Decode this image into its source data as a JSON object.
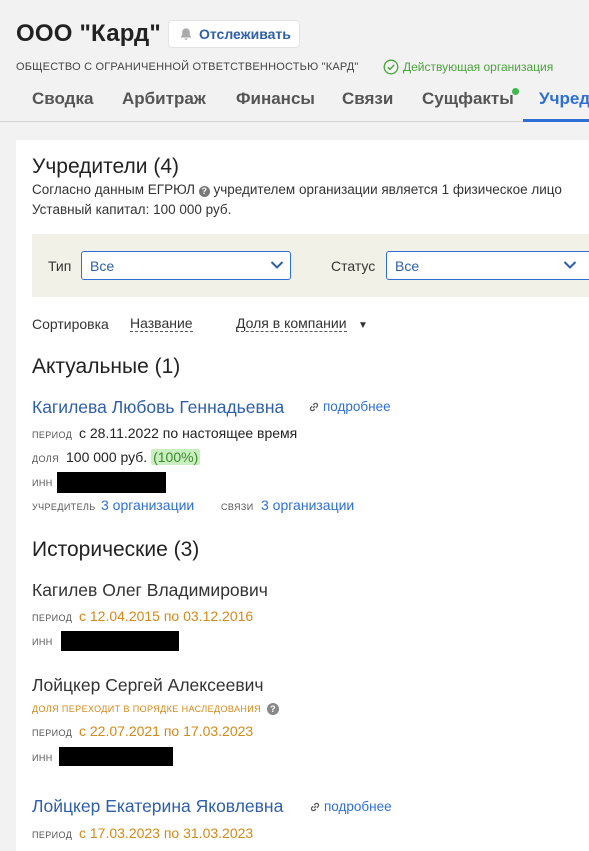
{
  "header": {
    "company_name": "ООО \"Кард\"",
    "follow_label": "Отслеживать",
    "full_name": "ОБЩЕСТВО С ОГРАНИЧЕННОЙ ОТВЕТСТВЕННОСТЬЮ \"КАРД\"",
    "status": "Действующая организация"
  },
  "tabs": [
    {
      "label": "Сводка"
    },
    {
      "label": "Арбитраж"
    },
    {
      "label": "Финансы"
    },
    {
      "label": "Связи"
    },
    {
      "label": "Сущфакты"
    },
    {
      "label": "Учреди"
    }
  ],
  "founders": {
    "title": "Учредители (4)",
    "desc_prefix": "Согласно данным ЕГРЮЛ",
    "desc_suffix": "учредителем организации является 1 физическое лицо",
    "capital": "Уставный капитал: 100 000 руб.",
    "filters": {
      "type_label": "Тип",
      "type_value": "Все",
      "status_label": "Статус",
      "status_value": "Все"
    },
    "sort": {
      "label": "Сортировка",
      "by_name": "Название",
      "by_share": "Доля в компании"
    },
    "current_title": "Актуальные (1)",
    "historical_title": "Исторические (3)",
    "current": [
      {
        "name": "Кагилева Любовь Геннадьевна",
        "more": "подробнее",
        "period_label": "период",
        "period": "с 28.11.2022 по настоящее время",
        "share_label": "доля",
        "share": "100 000 руб.",
        "share_pct": "(100%)",
        "inn_label": "инн",
        "founder_label": "учредитель",
        "founder_value": "3 организации",
        "links_label": "связи",
        "links_value": "3 организации"
      }
    ],
    "historical": [
      {
        "name": "Кагилев Олег Владимирович",
        "period_label": "период",
        "period": "с 12.04.2015 по 03.12.2016",
        "inn_label": "инн"
      },
      {
        "name": "Лойцкер Сергей Алексеевич",
        "note": "ДОЛЯ ПЕРЕХОДИТ В ПОРЯДКЕ НАСЛЕДОВАНИЯ",
        "period_label": "период",
        "period": "с 22.07.2021 по 17.03.2023",
        "inn_label": "инн"
      },
      {
        "name": "Лойцкер Екатерина Яковлевна",
        "more": "подробнее",
        "period_label": "период",
        "period": "с 17.03.2023 по 31.03.2023"
      }
    ]
  },
  "colors": {
    "link": "#2e5fa8",
    "active_tab": "#2e6fd6",
    "status_green": "#4aa33b",
    "historical_orange": "#d38a18",
    "filter_bg": "#f1f1e8"
  },
  "icons": [
    "bell-icon",
    "check-circle-icon",
    "info-icon",
    "chevron-down-icon",
    "link-icon",
    "caret-down-icon"
  ]
}
